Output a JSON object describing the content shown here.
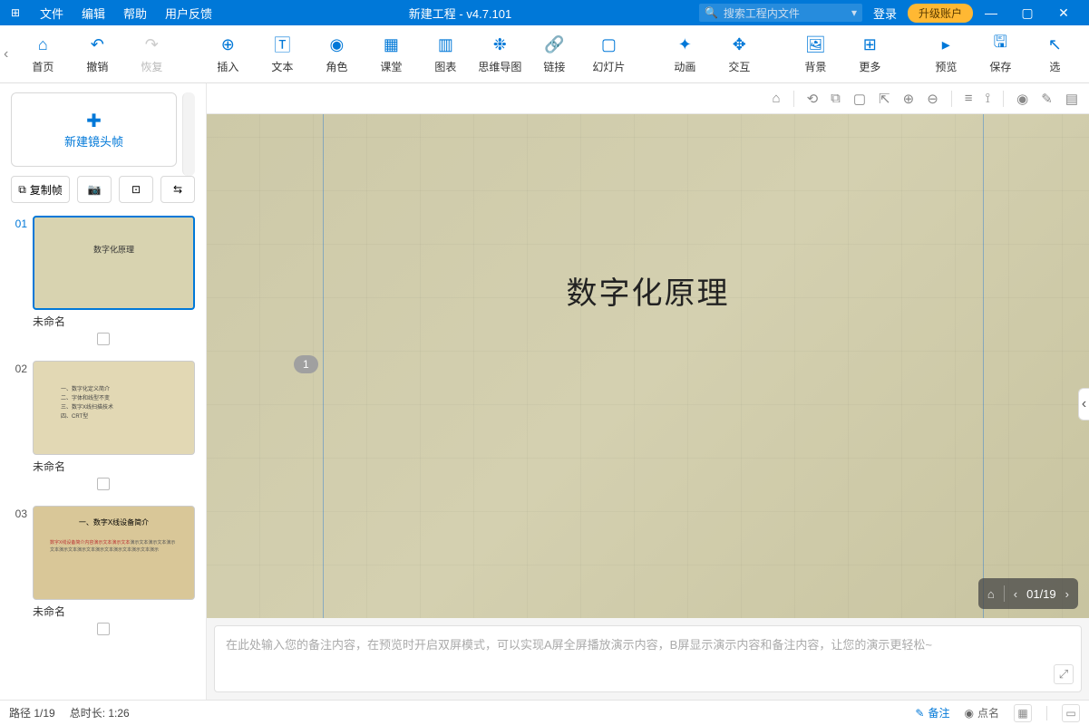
{
  "titlebar": {
    "menus": [
      "文件",
      "编辑",
      "帮助",
      "用户反馈"
    ],
    "title": "新建工程 - v4.7.101",
    "search_placeholder": "搜索工程内文件",
    "login": "登录",
    "upgrade": "升级账户"
  },
  "ribbon": {
    "home": "首页",
    "undo": "撤销",
    "redo": "恢复",
    "insert": "插入",
    "text": "文本",
    "role": "角色",
    "class": "课堂",
    "chart": "图表",
    "mindmap": "思维导图",
    "link": "链接",
    "slide": "幻灯片",
    "anim": "动画",
    "interact": "交互",
    "bg": "背景",
    "more": "更多",
    "preview": "预览",
    "save": "保存",
    "select": "选"
  },
  "sidebar": {
    "new_frame": "新建镜头帧",
    "copy_frame": "复制帧",
    "slides": [
      {
        "num": "01",
        "name": "未命名",
        "title": "数字化原理"
      },
      {
        "num": "02",
        "name": "未命名"
      },
      {
        "num": "03",
        "name": "未命名",
        "heading": "一、数字X线设备简介"
      }
    ]
  },
  "canvas": {
    "slide_title": "数字化原理",
    "step": "1",
    "page_indicator": "01/19",
    "notes_placeholder": "在此处输入您的备注内容，在预览时开启双屏模式，可以实现A屏全屏播放演示内容，B屏显示演示内容和备注内容，让您的演示更轻松~"
  },
  "statusbar": {
    "path": "路径 1/19",
    "duration": "总时长: 1:26",
    "notes": "备注",
    "roll": "点名"
  },
  "chart_data": null
}
